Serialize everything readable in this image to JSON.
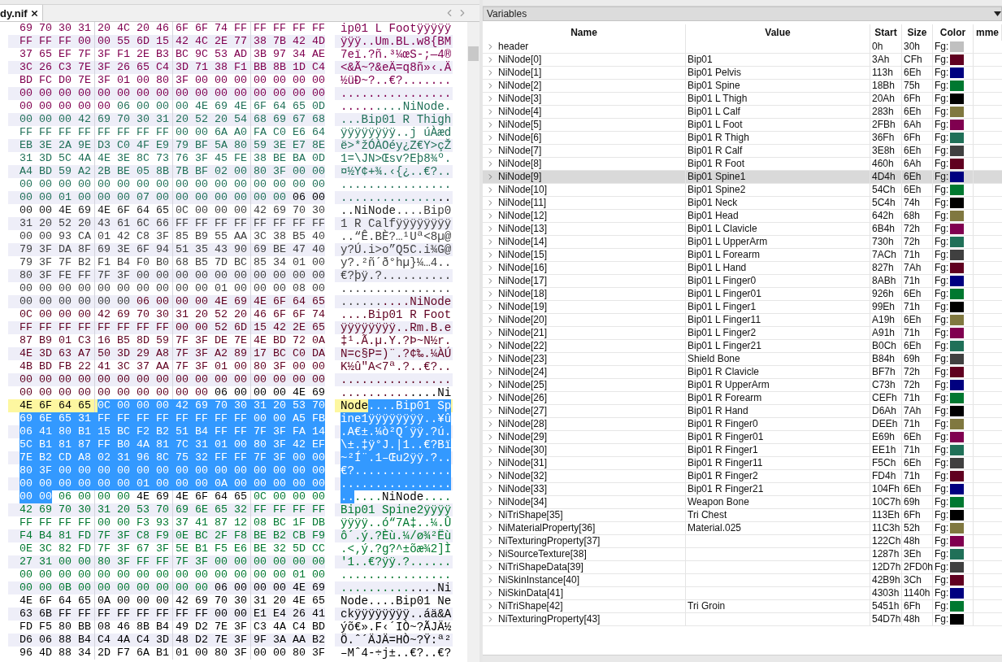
{
  "editor": {
    "tab": {
      "label": "dy.nif",
      "selected": true
    },
    "hex_rows": [
      {
        "current": false,
        "hex": [
          {
            "text": "69 70 30 31 20 4C 20 46 6F 6F 74 FF FF FF FF FF",
            "color": "#800050",
            "selected": false
          }
        ],
        "ascii": [
          {
            "text": "ip01 L Footÿÿÿÿÿ",
            "color": "#800050",
            "selected": false
          }
        ]
      },
      {
        "current": false,
        "hex": [
          {
            "text": "FF FF FF 00 00 55 6D 15 42 4C 2E 77 38 7B 42 4D",
            "color": "#800050",
            "selected": false
          }
        ],
        "ascii": [
          {
            "text": "ÿÿÿ..Um.BL.w8{BM",
            "color": "#800050",
            "selected": false
          }
        ]
      },
      {
        "current": false,
        "hex": [
          {
            "text": "37 65 EF 7F 3F F1 2E B3 BC 9C 53 AD 3B 97 34 AE",
            "color": "#800050",
            "selected": false
          }
        ],
        "ascii": [
          {
            "text": "7eï.?ñ.³¼œS-;—4®",
            "color": "#800050",
            "selected": false
          }
        ]
      },
      {
        "current": false,
        "hex": [
          {
            "text": "3C 26 C3 7E 3F 26 65 C4 3D 71 38 F1 BB 8B 1D C4",
            "color": "#800050",
            "selected": false
          }
        ],
        "ascii": [
          {
            "text": "<&Ã~?&eÄ=q8ñ»‹.Ä",
            "color": "#800050",
            "selected": false
          }
        ]
      },
      {
        "current": false,
        "hex": [
          {
            "text": "BD FC D0 7E 3F 01 00 80 3F 00 00 00 00 00 00 00",
            "color": "#800050",
            "selected": false
          }
        ],
        "ascii": [
          {
            "text": "½üÐ~?..€?.......",
            "color": "#800050",
            "selected": false
          }
        ]
      },
      {
        "current": false,
        "hex": [
          {
            "text": "00 00 00 00 00 00 00 00 00 00 00 00 00 00 00 00",
            "color": "#800050",
            "selected": false
          }
        ],
        "ascii": [
          {
            "text": "................",
            "color": "#800050",
            "selected": false
          }
        ]
      },
      {
        "current": false,
        "hex": [
          {
            "text": "00 00 00 00 00",
            "color": "#800050",
            "selected": false
          },
          {
            "text": "06 00 00 00 4E 69 4E 6F 64 65 0D",
            "color": "#207058",
            "selected": false
          }
        ],
        "ascii": [
          {
            "text": ".....",
            "color": "#800050",
            "selected": false
          },
          {
            "text": "....NiNode.",
            "color": "#207058",
            "selected": false
          }
        ]
      },
      {
        "current": false,
        "hex": [
          {
            "text": "00 00 00 42 69 70 30 31 20 52 20 54 68 69 67 68",
            "color": "#207058",
            "selected": false
          }
        ],
        "ascii": [
          {
            "text": "...Bip01 R Thigh",
            "color": "#207058",
            "selected": false
          }
        ]
      },
      {
        "current": false,
        "hex": [
          {
            "text": "FF FF FF FF FF FF FF FF 00 00 6A A0 FA C0 E6 64",
            "color": "#207058",
            "selected": false
          }
        ],
        "ascii": [
          {
            "text": "ÿÿÿÿÿÿÿÿ..j úÀæd",
            "color": "#207058",
            "selected": false
          }
        ]
      },
      {
        "current": false,
        "hex": [
          {
            "text": "EB 3E 2A 9E D3 C0 4F E9 79 BF 5A 80 59 3E E7 8E",
            "color": "#207058",
            "selected": false
          }
        ],
        "ascii": [
          {
            "text": "ë>*žÓÀOéy¿Z€Y>çŽ",
            "color": "#207058",
            "selected": false
          }
        ]
      },
      {
        "current": false,
        "hex": [
          {
            "text": "31 3D 5C 4A 4E 3E 8C 73 76 3F 45 FE 38 BE BA 0D",
            "color": "#207058",
            "selected": false
          }
        ],
        "ascii": [
          {
            "text": "1=\\JN>Œsv?Eþ8¾º.",
            "color": "#207058",
            "selected": false
          }
        ]
      },
      {
        "current": false,
        "hex": [
          {
            "text": "A4 BD 59 A2 2B BE 05 8B 7B BF 02 00 80 3F 00 00",
            "color": "#207058",
            "selected": false
          }
        ],
        "ascii": [
          {
            "text": "¤½Y¢+¾.‹{¿..€?..",
            "color": "#207058",
            "selected": false
          }
        ]
      },
      {
        "current": false,
        "hex": [
          {
            "text": "00 00 00 00 00 00 00 00 00 00 00 00 00 00 00 00",
            "color": "#207058",
            "selected": false
          }
        ],
        "ascii": [
          {
            "text": "................",
            "color": "#207058",
            "selected": false
          }
        ]
      },
      {
        "current": false,
        "hex": [
          {
            "text": "00 00 01 00 00 00 07 00 00 00 00 00 00 00",
            "color": "#207058",
            "selected": false
          },
          {
            "text": "06 00",
            "selected": false
          }
        ],
        "ascii": [
          {
            "text": "..............",
            "color": "#207058",
            "selected": false
          },
          {
            "text": "..",
            "selected": false
          }
        ]
      },
      {
        "current": false,
        "hex": [
          {
            "text": "00 00 4E 69 4E 6F 64 65",
            "color": "#202020",
            "selected": false
          },
          {
            "text": "0C 00 00 00 42 69 70 30",
            "color": "#404040",
            "selected": false
          }
        ],
        "ascii": [
          {
            "text": "..NiNode",
            "color": "#202020",
            "selected": false
          },
          {
            "text": "....Bip0",
            "color": "#404040",
            "selected": false
          }
        ]
      },
      {
        "current": false,
        "hex": [
          {
            "text": "31 20 52 20 43 61 6C 66 FF FF FF FF FF FF FF FF",
            "color": "#404040",
            "selected": false
          }
        ],
        "ascii": [
          {
            "text": "1 R Calfÿÿÿÿÿÿÿÿ",
            "color": "#404040",
            "selected": false
          }
        ]
      },
      {
        "current": false,
        "hex": [
          {
            "text": "00 00 93 CA 01 42 C8 3F 85 B9 55 AA 3C 38 B5 40",
            "color": "#404040",
            "selected": false
          }
        ],
        "ascii": [
          {
            "text": "..“Ê.BÈ?…¹Uª<8µ@",
            "color": "#404040",
            "selected": false
          }
        ]
      },
      {
        "current": false,
        "hex": [
          {
            "text": "79 3F DA 8F 69 3E 6F 94 51 35 43 90 69 BE 47 40",
            "color": "#404040",
            "selected": false
          }
        ],
        "ascii": [
          {
            "text": "y?Ú.i>o”Q5C.i¾G@",
            "color": "#404040",
            "selected": false
          }
        ]
      },
      {
        "current": false,
        "hex": [
          {
            "text": "79 3F 7F B2 F1 B4 F0 B0 68 B5 7D BC 85 34 01 00",
            "color": "#404040",
            "selected": false
          }
        ],
        "ascii": [
          {
            "text": "y?.²ñ´ð°hµ}¼…4..",
            "color": "#404040",
            "selected": false
          }
        ]
      },
      {
        "current": false,
        "hex": [
          {
            "text": "80 3F FE FF 7F 3F 00 00 00 00 00 00 00 00 00 00",
            "color": "#404040",
            "selected": false
          }
        ],
        "ascii": [
          {
            "text": "€?þÿ.?..........",
            "color": "#404040",
            "selected": false
          }
        ]
      },
      {
        "current": false,
        "hex": [
          {
            "text": "00 00 00 00 00 00 00 00 00 00 01 00 00 00 08 00",
            "color": "#404040",
            "selected": false
          }
        ],
        "ascii": [
          {
            "text": "................",
            "color": "#404040",
            "selected": false
          }
        ]
      },
      {
        "current": false,
        "hex": [
          {
            "text": "00 00 00 00 00 00",
            "color": "#404040",
            "selected": false
          },
          {
            "text": "06 00 00 00 4E 69 4E 6F 64 65",
            "color": "#600020",
            "selected": false
          }
        ],
        "ascii": [
          {
            "text": "......",
            "color": "#404040",
            "selected": false
          },
          {
            "text": "....NiNode",
            "color": "#600020",
            "selected": false
          }
        ]
      },
      {
        "current": false,
        "hex": [
          {
            "text": "0C 00 00 00 42 69 70 30 31 20 52 20 46 6F 6F 74",
            "color": "#600020",
            "selected": false
          }
        ],
        "ascii": [
          {
            "text": "....Bip01 R Foot",
            "color": "#600020",
            "selected": false
          }
        ]
      },
      {
        "current": false,
        "hex": [
          {
            "text": "FF FF FF FF FF FF FF FF 00 00 52 6D 15 42 2E 65",
            "color": "#600020",
            "selected": false
          }
        ],
        "ascii": [
          {
            "text": "ÿÿÿÿÿÿÿÿ..Rm.B.e",
            "color": "#600020",
            "selected": false
          }
        ]
      },
      {
        "current": false,
        "hex": [
          {
            "text": "87 B9 01 C3 16 B5 8D 59 7F 3F DE 7E 4E BD 72 0A",
            "color": "#600020",
            "selected": false
          }
        ],
        "ascii": [
          {
            "text": "‡¹.Ã.µ.Y.?Þ~N½r.",
            "color": "#600020",
            "selected": false
          }
        ]
      },
      {
        "current": false,
        "hex": [
          {
            "text": "4E 3D 63 A7 50 3D 29 A8 7F 3F A2 89 17 BC C0 DA",
            "color": "#600020",
            "selected": false
          }
        ],
        "ascii": [
          {
            "text": "N=c§P=)¨.?¢‰.¼ÀÚ",
            "color": "#600020",
            "selected": false
          }
        ]
      },
      {
        "current": false,
        "hex": [
          {
            "text": "4B BD FB 22 41 3C 37 AA 7F 3F 01 00 80 3F 00 00",
            "color": "#600020",
            "selected": false
          }
        ],
        "ascii": [
          {
            "text": "K½û\"A<7ª.?..€?..",
            "color": "#600020",
            "selected": false
          }
        ]
      },
      {
        "current": false,
        "hex": [
          {
            "text": "00 00 00 00 00 00 00 00 00 00 00 00 00 00 00 00",
            "color": "#600020",
            "selected": false
          }
        ],
        "ascii": [
          {
            "text": "................",
            "color": "#600020",
            "selected": false
          }
        ]
      },
      {
        "current": false,
        "hex": [
          {
            "text": "00 00 00 00 00 00 00 00 00 00",
            "color": "#600020",
            "selected": false
          },
          {
            "text": "06 00 00 00 4E 69",
            "color": "#000000",
            "selected": false
          }
        ],
        "ascii": [
          {
            "text": "..........",
            "color": "#600020",
            "selected": false
          },
          {
            "text": "....Ni",
            "color": "#000000",
            "selected": false
          }
        ]
      },
      {
        "current": true,
        "hex": [
          {
            "text": "4E 6F 64 65",
            "selected": false
          },
          {
            "text": "0C 00 00 00 42 69 70 30 31 20 53 70",
            "selected": true
          }
        ],
        "ascii": [
          {
            "text": "Node",
            "selected": false
          },
          {
            "text": "....Bip01 Sp",
            "selected": true
          }
        ]
      },
      {
        "current": false,
        "hex": [
          {
            "text": "69 6E 65 31 FF FF FF FF FF FF FF FF 00 00 A5 FB",
            "selected": true
          }
        ],
        "ascii": [
          {
            "text": "ine1ÿÿÿÿÿÿÿÿ..¥û",
            "selected": true
          }
        ]
      },
      {
        "current": false,
        "hex": [
          {
            "text": "06 41 80 B1 15 BC F2 B2 51 B4 FF FF 7F 3F FA 14",
            "selected": true
          }
        ],
        "ascii": [
          {
            "text": ".A€±.¼ò²Q´ÿÿ.?ú.",
            "selected": true
          }
        ]
      },
      {
        "current": false,
        "hex": [
          {
            "text": "5C B1 81 87 FF B0 4A 81 7C 31 01 00 80 3F 42 EF",
            "selected": true
          }
        ],
        "ascii": [
          {
            "text": "\\±.‡ÿ°J.|1..€?Bï",
            "selected": true
          }
        ]
      },
      {
        "current": false,
        "hex": [
          {
            "text": "7E B2 CD A8 02 31 96 8C 75 32 FF FF 7F 3F 00 00",
            "selected": true
          }
        ],
        "ascii": [
          {
            "text": "~²Í¨.1–Œu2ÿÿ.?..",
            "selected": true
          }
        ]
      },
      {
        "current": false,
        "hex": [
          {
            "text": "80 3F 00 00 00 00 00 00 00 00 00 00 00 00 00 00",
            "selected": true
          }
        ],
        "ascii": [
          {
            "text": "€?..............",
            "selected": true
          }
        ]
      },
      {
        "current": false,
        "hex": [
          {
            "text": "00 00 00 00 00 00 01 00 00 00 0A 00 00 00 00 00",
            "selected": true
          }
        ],
        "ascii": [
          {
            "text": "................",
            "selected": true
          }
        ]
      },
      {
        "current": false,
        "hex": [
          {
            "text": "00 00",
            "selected": true
          },
          {
            "text": "06 00 00 00",
            "color": "#007830",
            "selected": false
          },
          {
            "text": "4E 69 4E 6F 64 65",
            "color": "#000000",
            "selected": false
          },
          {
            "text": "0C 00 00 00",
            "color": "#007830",
            "selected": false
          }
        ],
        "ascii": [
          {
            "text": "..",
            "selected": true
          },
          {
            "text": "....",
            "color": "#007830",
            "selected": false
          },
          {
            "text": "NiNode",
            "color": "#000000",
            "selected": false
          },
          {
            "text": "....",
            "color": "#007830",
            "selected": false
          }
        ]
      },
      {
        "current": false,
        "hex": [
          {
            "text": "42 69 70 30 31 20 53 70 69 6E 65 32 FF FF FF FF",
            "color": "#007830",
            "selected": false
          }
        ],
        "ascii": [
          {
            "text": "Bip01 Spine2ÿÿÿÿ",
            "color": "#007830",
            "selected": false
          }
        ]
      },
      {
        "current": false,
        "hex": [
          {
            "text": "FF FF FF FF 00 00 F3 93 37 41 87 12 08 BC 1F DB",
            "color": "#007830",
            "selected": false
          }
        ],
        "ascii": [
          {
            "text": "ÿÿÿÿ..ó“7A‡..¼.Û",
            "color": "#007830",
            "selected": false
          }
        ]
      },
      {
        "current": false,
        "hex": [
          {
            "text": "F4 B4 81 FD 7F 3F C8 F9 0E BC 2F F8 BE B2 CB F9",
            "color": "#007830",
            "selected": false
          }
        ],
        "ascii": [
          {
            "text": "ô´.ý.?Èù.¼/ø¾²Ëù",
            "color": "#007830",
            "selected": false
          }
        ]
      },
      {
        "current": false,
        "hex": [
          {
            "text": "0E 3C 82 FD 7F 3F 67 3F 5E B1 F5 E6 BE 32 5D CC",
            "color": "#007830",
            "selected": false
          }
        ],
        "ascii": [
          {
            "text": ".<‚ý.?g?^±õæ¾2]Ì",
            "color": "#007830",
            "selected": false
          }
        ]
      },
      {
        "current": false,
        "hex": [
          {
            "text": "27 31 00 00 80 3F FF FF 7F 3F 00 00 00 00 00 00",
            "color": "#007830",
            "selected": false
          }
        ],
        "ascii": [
          {
            "text": "'1..€?ÿÿ.?......",
            "color": "#007830",
            "selected": false
          }
        ]
      },
      {
        "current": false,
        "hex": [
          {
            "text": "00 00 00 00 00 00 00 00 00 00 00 00 00 00 01 00",
            "color": "#007830",
            "selected": false
          }
        ],
        "ascii": [
          {
            "text": "................",
            "color": "#007830",
            "selected": false
          }
        ]
      },
      {
        "current": false,
        "hex": [
          {
            "text": "00 00 0B 00 00 00 00 00 00 00",
            "color": "#007830",
            "selected": false
          },
          {
            "text": "06 00 00 00 4E 69",
            "color": "#000000",
            "selected": false
          }
        ],
        "ascii": [
          {
            "text": "..........",
            "color": "#007830",
            "selected": false
          },
          {
            "text": "....Ni",
            "color": "#000000",
            "selected": false
          }
        ]
      },
      {
        "current": false,
        "hex": [
          {
            "text": "4E 6F 64 65 0A 00 00 00 42 69 70 30 31 20 4E 65",
            "color": "#000000",
            "selected": false
          }
        ],
        "ascii": [
          {
            "text": "Node....Bip01 Ne",
            "color": "#000000",
            "selected": false
          }
        ]
      },
      {
        "current": false,
        "hex": [
          {
            "text": "63 6B FF FF FF FF FF FF FF FF 00 00 E1 E4 26 41",
            "color": "#000000",
            "selected": false
          }
        ],
        "ascii": [
          {
            "text": "ckÿÿÿÿÿÿÿÿ..áä&A",
            "color": "#000000",
            "selected": false
          }
        ]
      },
      {
        "current": false,
        "hex": [
          {
            "text": "FD F5 80 BB 08 46 8B B4 49 D2 7E 3F C3 4A C4 BD",
            "color": "#000000",
            "selected": false
          }
        ],
        "ascii": [
          {
            "text": "ýõ€».F‹´IÒ~?ÃJÄ½",
            "color": "#000000",
            "selected": false
          }
        ]
      },
      {
        "current": false,
        "hex": [
          {
            "text": "D6 06 88 B4 C4 4A C4 3D 48 D2 7E 3F 9F 3A AA B2",
            "color": "#000000",
            "selected": false
          }
        ],
        "ascii": [
          {
            "text": "Ö.ˆ´ÄJÄ=HÒ~?Ÿ:ª²",
            "color": "#000000",
            "selected": false
          }
        ]
      },
      {
        "current": false,
        "hex": [
          {
            "text": "96 4D 88 34 2D F7 6A B1 01 00 80 3F 00 00 80 3F",
            "color": "#000000",
            "selected": false
          }
        ],
        "ascii": [
          {
            "text": "–Mˆ4-÷j±..€?..€?",
            "color": "#000000",
            "selected": false
          }
        ]
      }
    ]
  },
  "variables": {
    "title": "Variables",
    "columns": [
      "Name",
      "Value",
      "Start",
      "Size",
      "Color",
      "mme"
    ],
    "rows": [
      {
        "name": "header",
        "start": "0h",
        "size": "30h",
        "fg": "Fg:",
        "color": "#c0c0c0",
        "selected": false
      },
      {
        "name": "NiNode[0]",
        "value": "Bip01",
        "start": "3Ah",
        "size": "CFh",
        "fg": "Fg:",
        "color": "#600020",
        "selected": false
      },
      {
        "name": "NiNode[1]",
        "value": "Bip01 Pelvis",
        "start": "113h",
        "size": "6Eh",
        "fg": "Fg:",
        "color": "#000080",
        "selected": false
      },
      {
        "name": "NiNode[2]",
        "value": "Bip01 Spine",
        "start": "18Bh",
        "size": "75h",
        "fg": "Fg:",
        "color": "#007830",
        "selected": false
      },
      {
        "name": "NiNode[3]",
        "value": "Bip01 L Thigh",
        "start": "20Ah",
        "size": "6Fh",
        "fg": "Fg:",
        "color": "#000000",
        "selected": false
      },
      {
        "name": "NiNode[4]",
        "value": "Bip01 L Calf",
        "start": "283h",
        "size": "6Eh",
        "fg": "Fg:",
        "color": "#807840",
        "selected": false
      },
      {
        "name": "NiNode[5]",
        "value": "Bip01 L Foot",
        "start": "2FBh",
        "size": "6Ah",
        "fg": "Fg:",
        "color": "#800050",
        "selected": false
      },
      {
        "name": "NiNode[6]",
        "value": "Bip01 R Thigh",
        "start": "36Fh",
        "size": "6Fh",
        "fg": "Fg:",
        "color": "#207058",
        "selected": false
      },
      {
        "name": "NiNode[7]",
        "value": "Bip01 R Calf",
        "start": "3E8h",
        "size": "6Eh",
        "fg": "Fg:",
        "color": "#404040",
        "selected": false
      },
      {
        "name": "NiNode[8]",
        "value": "Bip01 R Foot",
        "start": "460h",
        "size": "6Ah",
        "fg": "Fg:",
        "color": "#600020",
        "selected": false
      },
      {
        "name": "NiNode[9]",
        "value": "Bip01 Spine1",
        "start": "4D4h",
        "size": "6Eh",
        "fg": "Fg:",
        "color": "#000080",
        "selected": true
      },
      {
        "name": "NiNode[10]",
        "value": "Bip01 Spine2",
        "start": "54Ch",
        "size": "6Eh",
        "fg": "Fg:",
        "color": "#007830",
        "selected": false
      },
      {
        "name": "NiNode[11]",
        "value": "Bip01 Neck",
        "start": "5C4h",
        "size": "74h",
        "fg": "Fg:",
        "color": "#000000",
        "selected": false
      },
      {
        "name": "NiNode[12]",
        "value": "Bip01 Head",
        "start": "642h",
        "size": "68h",
        "fg": "Fg:",
        "color": "#807840",
        "selected": false
      },
      {
        "name": "NiNode[13]",
        "value": "Bip01 L Clavicle",
        "start": "6B4h",
        "size": "72h",
        "fg": "Fg:",
        "color": "#800050",
        "selected": false
      },
      {
        "name": "NiNode[14]",
        "value": "Bip01 L UpperArm",
        "start": "730h",
        "size": "72h",
        "fg": "Fg:",
        "color": "#207058",
        "selected": false
      },
      {
        "name": "NiNode[15]",
        "value": "Bip01 L Forearm",
        "start": "7ACh",
        "size": "71h",
        "fg": "Fg:",
        "color": "#404040",
        "selected": false
      },
      {
        "name": "NiNode[16]",
        "value": "Bip01 L Hand",
        "start": "827h",
        "size": "7Ah",
        "fg": "Fg:",
        "color": "#600020",
        "selected": false
      },
      {
        "name": "NiNode[17]",
        "value": "Bip01 L Finger0",
        "start": "8ABh",
        "size": "71h",
        "fg": "Fg:",
        "color": "#000080",
        "selected": false
      },
      {
        "name": "NiNode[18]",
        "value": "Bip01 L Finger01",
        "start": "926h",
        "size": "6Eh",
        "fg": "Fg:",
        "color": "#007830",
        "selected": false
      },
      {
        "name": "NiNode[19]",
        "value": "Bip01 L Finger1",
        "start": "99Eh",
        "size": "71h",
        "fg": "Fg:",
        "color": "#000000",
        "selected": false
      },
      {
        "name": "NiNode[20]",
        "value": "Bip01 L Finger11",
        "start": "A19h",
        "size": "6Eh",
        "fg": "Fg:",
        "color": "#807840",
        "selected": false
      },
      {
        "name": "NiNode[21]",
        "value": "Bip01 L Finger2",
        "start": "A91h",
        "size": "71h",
        "fg": "Fg:",
        "color": "#800050",
        "selected": false
      },
      {
        "name": "NiNode[22]",
        "value": "Bip01 L Finger21",
        "start": "B0Ch",
        "size": "6Eh",
        "fg": "Fg:",
        "color": "#207058",
        "selected": false
      },
      {
        "name": "NiNode[23]",
        "value": "Shield Bone",
        "start": "B84h",
        "size": "69h",
        "fg": "Fg:",
        "color": "#404040",
        "selected": false
      },
      {
        "name": "NiNode[24]",
        "value": "Bip01 R Clavicle",
        "start": "BF7h",
        "size": "72h",
        "fg": "Fg:",
        "color": "#600020",
        "selected": false
      },
      {
        "name": "NiNode[25]",
        "value": "Bip01 R UpperArm",
        "start": "C73h",
        "size": "72h",
        "fg": "Fg:",
        "color": "#000080",
        "selected": false
      },
      {
        "name": "NiNode[26]",
        "value": "Bip01 R Forearm",
        "start": "CEFh",
        "size": "71h",
        "fg": "Fg:",
        "color": "#007830",
        "selected": false
      },
      {
        "name": "NiNode[27]",
        "value": "Bip01 R Hand",
        "start": "D6Ah",
        "size": "7Ah",
        "fg": "Fg:",
        "color": "#000000",
        "selected": false
      },
      {
        "name": "NiNode[28]",
        "value": "Bip01 R Finger0",
        "start": "DEEh",
        "size": "71h",
        "fg": "Fg:",
        "color": "#807840",
        "selected": false
      },
      {
        "name": "NiNode[29]",
        "value": "Bip01 R Finger01",
        "start": "E69h",
        "size": "6Eh",
        "fg": "Fg:",
        "color": "#800050",
        "selected": false
      },
      {
        "name": "NiNode[30]",
        "value": "Bip01 R Finger1",
        "start": "EE1h",
        "size": "71h",
        "fg": "Fg:",
        "color": "#207058",
        "selected": false
      },
      {
        "name": "NiNode[31]",
        "value": "Bip01 R Finger11",
        "start": "F5Ch",
        "size": "6Eh",
        "fg": "Fg:",
        "color": "#404040",
        "selected": false
      },
      {
        "name": "NiNode[32]",
        "value": "Bip01 R Finger2",
        "start": "FD4h",
        "size": "71h",
        "fg": "Fg:",
        "color": "#600020",
        "selected": false
      },
      {
        "name": "NiNode[33]",
        "value": "Bip01 R Finger21",
        "start": "104Fh",
        "size": "6Eh",
        "fg": "Fg:",
        "color": "#000080",
        "selected": false
      },
      {
        "name": "NiNode[34]",
        "value": "Weapon Bone",
        "start": "10C7h",
        "size": "69h",
        "fg": "Fg:",
        "color": "#007830",
        "selected": false
      },
      {
        "name": "NiTriShape[35]",
        "value": "Tri Chest",
        "start": "113Eh",
        "size": "6Fh",
        "fg": "Fg:",
        "color": "#000000",
        "selected": false
      },
      {
        "name": "NiMaterialProperty[36]",
        "value": "Material.025",
        "start": "11C3h",
        "size": "52h",
        "fg": "Fg:",
        "color": "#807840",
        "selected": false
      },
      {
        "name": "NiTexturingProperty[37]",
        "start": "122Ch",
        "size": "48h",
        "fg": "Fg:",
        "color": "#800050",
        "selected": false
      },
      {
        "name": "NiSourceTexture[38]",
        "start": "1287h",
        "size": "3Eh",
        "fg": "Fg:",
        "color": "#207058",
        "selected": false
      },
      {
        "name": "NiTriShapeData[39]",
        "start": "12D7h",
        "size": "2FD0h",
        "fg": "Fg:",
        "color": "#404040",
        "selected": false
      },
      {
        "name": "NiSkinInstance[40]",
        "start": "42B9h",
        "size": "3Ch",
        "fg": "Fg:",
        "color": "#600020",
        "selected": false
      },
      {
        "name": "NiSkinData[41]",
        "start": "4303h",
        "size": "1140h",
        "fg": "Fg:",
        "color": "#000080",
        "selected": false
      },
      {
        "name": "NiTriShape[42]",
        "value": "Tri Groin",
        "start": "5451h",
        "size": "6Fh",
        "fg": "Fg:",
        "color": "#007830",
        "selected": false
      },
      {
        "name": "NiTexturingProperty[43]",
        "start": "54D7h",
        "size": "48h",
        "fg": "Fg:",
        "color": "#000000",
        "selected": false
      }
    ]
  }
}
